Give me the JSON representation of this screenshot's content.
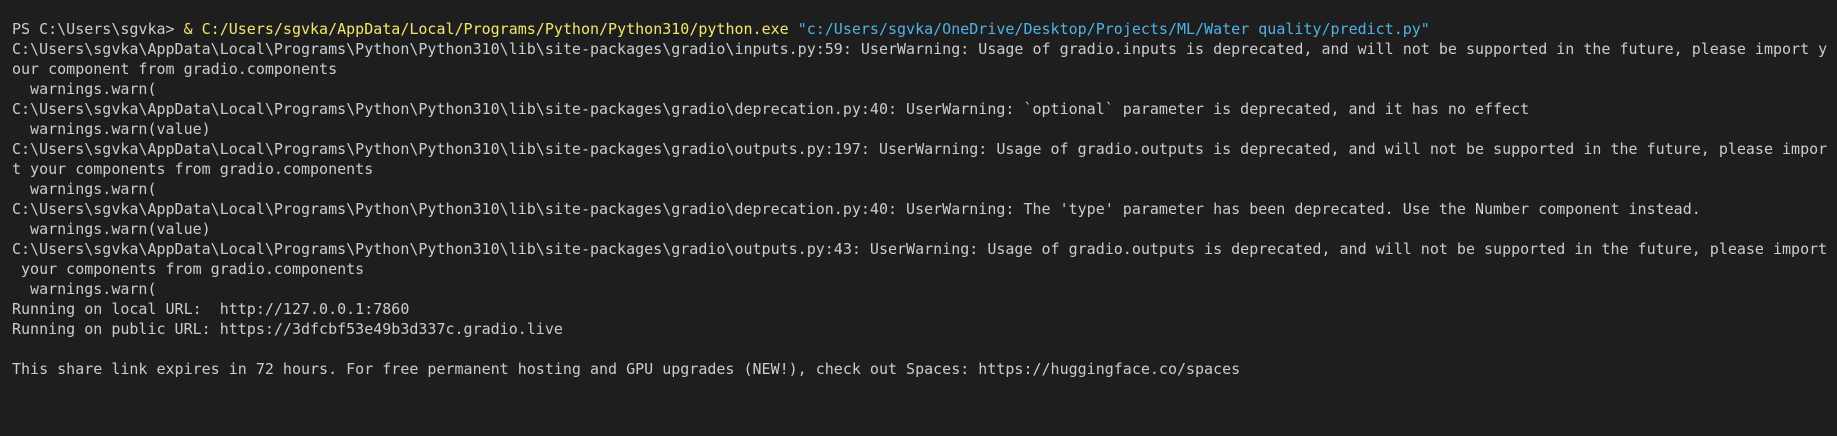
{
  "terminal": {
    "prompt": "PS C:\\Users\\sgvka> ",
    "operator": "&",
    "executable": "C:/Users/sgvka/AppData/Local/Programs/Python/Python310/python.exe",
    "script_arg": "\"c:/Users/sgvka/OneDrive/Desktop/Projects/ML/Water quality/predict.py\"",
    "lines": [
      "C:\\Users\\sgvka\\AppData\\Local\\Programs\\Python\\Python310\\lib\\site-packages\\gradio\\inputs.py:59: UserWarning: Usage of gradio.inputs is deprecated, and will not be supported in the future, please import y",
      "our component from gradio.components",
      "  warnings.warn(",
      "C:\\Users\\sgvka\\AppData\\Local\\Programs\\Python\\Python310\\lib\\site-packages\\gradio\\deprecation.py:40: UserWarning: `optional` parameter is deprecated, and it has no effect",
      "  warnings.warn(value)",
      "C:\\Users\\sgvka\\AppData\\Local\\Programs\\Python\\Python310\\lib\\site-packages\\gradio\\outputs.py:197: UserWarning: Usage of gradio.outputs is deprecated, and will not be supported in the future, please impor",
      "t your components from gradio.components",
      "  warnings.warn(",
      "C:\\Users\\sgvka\\AppData\\Local\\Programs\\Python\\Python310\\lib\\site-packages\\gradio\\deprecation.py:40: UserWarning: The 'type' parameter has been deprecated. Use the Number component instead.",
      "  warnings.warn(value)",
      "C:\\Users\\sgvka\\AppData\\Local\\Programs\\Python\\Python310\\lib\\site-packages\\gradio\\outputs.py:43: UserWarning: Usage of gradio.outputs is deprecated, and will not be supported in the future, please import",
      " your components from gradio.components",
      "  warnings.warn(",
      "Running on local URL:  http://127.0.0.1:7860",
      "Running on public URL: https://3dfcbf53e49b3d337c.gradio.live",
      "",
      "This share link expires in 72 hours. For free permanent hosting and GPU upgrades (NEW!), check out Spaces: https://huggingface.co/spaces"
    ]
  },
  "colors": {
    "background": "#1e1e1e",
    "text": "#cccccc",
    "command": "#f5e66a",
    "string": "#4fb3e8"
  }
}
